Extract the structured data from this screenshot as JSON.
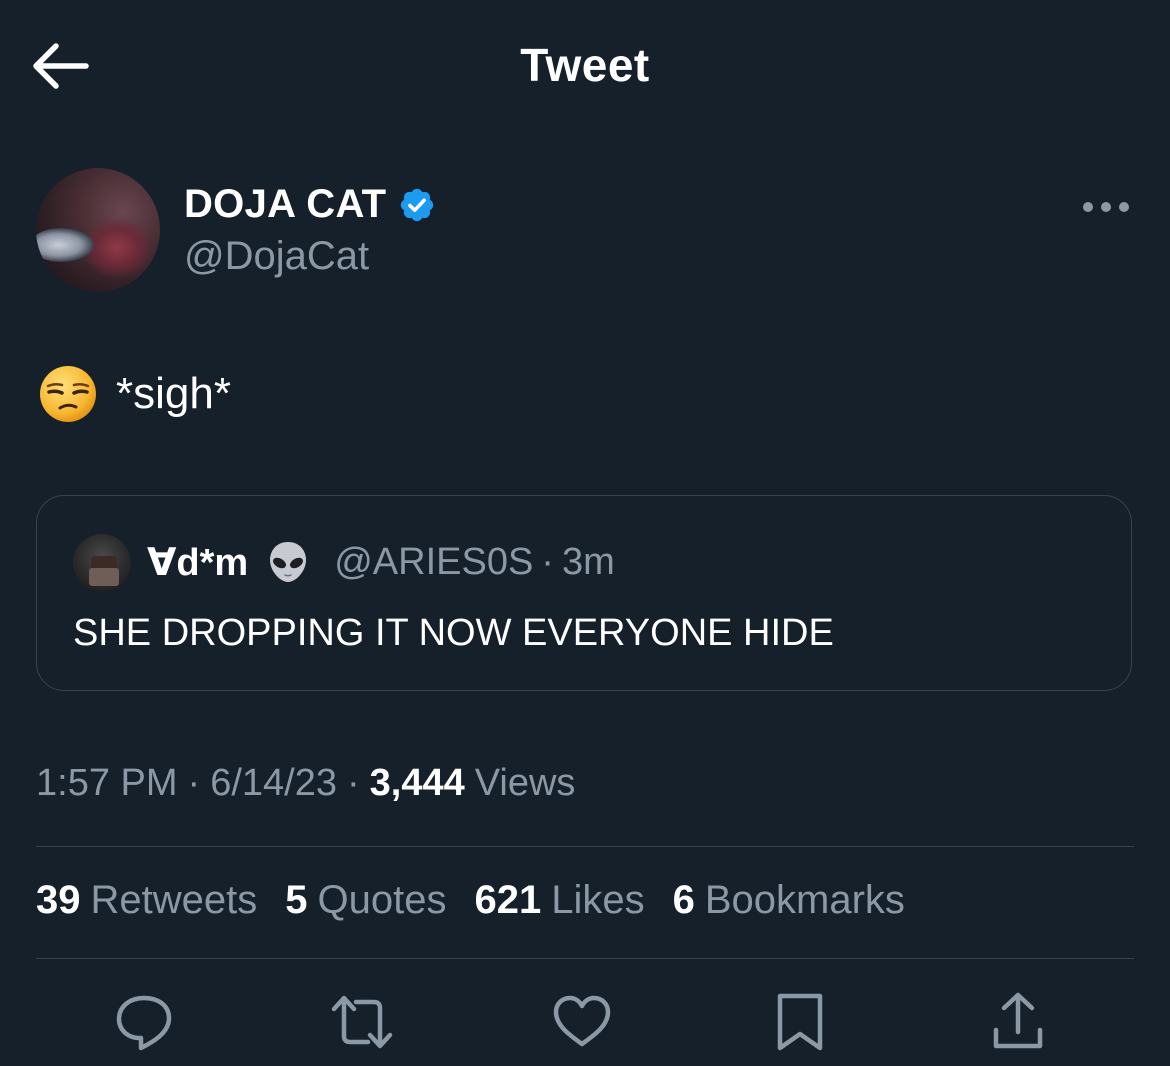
{
  "header": {
    "title": "Tweet"
  },
  "author": {
    "display_name": "DOJA CAT",
    "handle": "@DojaCat",
    "verified": true
  },
  "tweet": {
    "emoji": "unamused-face-emoji",
    "text": "*sigh*"
  },
  "quote": {
    "display_name": "∀d*m",
    "emoji": "alien-emoji",
    "handle": "@ARIES0S",
    "separator": "·",
    "time": "3m",
    "text": "SHE DROPPING IT NOW EVERYONE HIDE"
  },
  "meta": {
    "time": "1:57 PM",
    "separator": "·",
    "date": "6/14/23",
    "views_count": "3,444",
    "views_label": "Views"
  },
  "stats": [
    {
      "count": "39",
      "label": "Retweets"
    },
    {
      "count": "5",
      "label": "Quotes"
    },
    {
      "count": "621",
      "label": "Likes"
    },
    {
      "count": "6",
      "label": "Bookmarks"
    }
  ],
  "actions": [
    "reply-icon",
    "retweet-icon",
    "like-icon",
    "bookmark-icon",
    "share-icon"
  ],
  "colors": {
    "background": "#15202b",
    "muted": "#8b98a5",
    "border": "#38444d",
    "verified": "#1d9bf0"
  }
}
